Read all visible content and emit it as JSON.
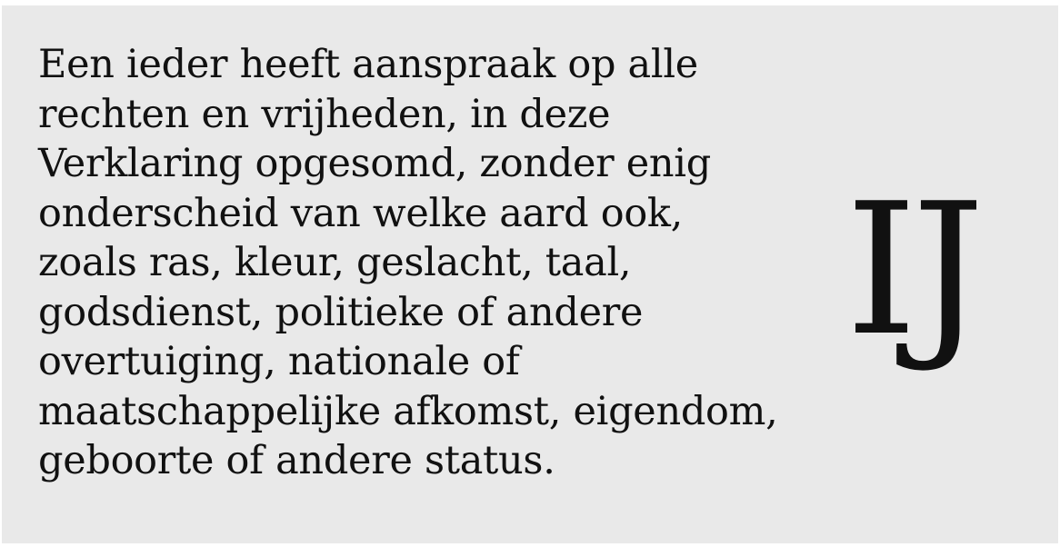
{
  "paragraph": {
    "lines": [
      "Een ieder heeft aanspraak op alle",
      "rechten en vrijheden, in deze",
      "Verklaring opgesomd, zonder enig",
      "onderscheid van welke aard ook,",
      "zoals ras, kleur, geslacht, taal,",
      "godsdienst, politieke of andere",
      "overtuiging, nationale of",
      "maatschappelijke afkomst, eigendom,",
      "geboorte of andere status."
    ]
  },
  "glyph": {
    "text": "IJ"
  },
  "colors": {
    "background": "#e9e9e9",
    "text": "#111111"
  }
}
